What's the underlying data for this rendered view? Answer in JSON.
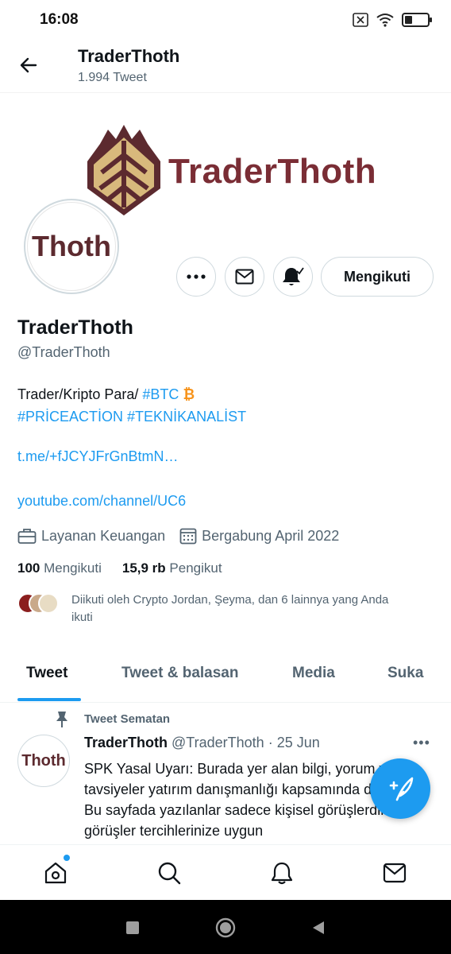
{
  "status_bar": {
    "time": "16:08",
    "battery_level": 0.35
  },
  "header": {
    "title": "TraderThoth",
    "subtitle": "1.994 Tweet"
  },
  "banner": {
    "brand_text": "TraderThoth"
  },
  "avatar": {
    "text": "Thoth"
  },
  "actions": {
    "follow_label": "Mengikuti"
  },
  "profile": {
    "display_name": "TraderThoth",
    "handle": "@TraderThoth",
    "bio_prefix": "Trader/Kripto Para/ ",
    "bio_tag_btc": "#BTC",
    "bio_tag_priceaction": "#PRİCEACTİON",
    "bio_tag_teknikanalist": "#TEKNİKANALİST",
    "link_telegram": "t.me/+fJCYJFrGnBtmN…",
    "link_youtube": "youtube.com/channel/UC6",
    "category": "Layanan Keuangan",
    "joined": "Bergabung April 2022",
    "following_count": "100",
    "following_label": "Mengikuti",
    "followers_count": "15,9 rb",
    "followers_label": "Pengikut",
    "followed_by_text": "Diikuti oleh Crypto Jordan, Şeyma, dan 6 lainnya yang Anda ikuti"
  },
  "tabs": [
    {
      "label": "Tweet",
      "active": true
    },
    {
      "label": "Tweet & balasan",
      "active": false
    },
    {
      "label": "Media",
      "active": false
    },
    {
      "label": "Suka",
      "active": false
    }
  ],
  "pinned_tweet": {
    "pinned_label": "Tweet Sematan",
    "avatar_text": "Thoth",
    "name": "TraderThoth",
    "handle": "@TraderThoth",
    "date": "25 Jun",
    "text": "SPK Yasal Uyarı: Burada yer alan bilgi, yorum ve tavsiyeler yatırım danışmanlığı kapsamında değildir. Bu sayfada yazılanlar sadece kişisel görüşlerdir. Bu görüşler tercihlerinize uygun"
  },
  "colors": {
    "accent": "#1d9bf0",
    "brand": "#7a2d35",
    "muted": "#536471"
  },
  "icons": {
    "back": "arrow-left-icon",
    "more": "more-icon",
    "message": "mail-icon",
    "notify": "bell-icon",
    "category": "briefcase-icon",
    "joined": "calendar-icon",
    "pin": "pin-icon",
    "compose": "compose-icon",
    "nav": [
      "home-icon",
      "search-icon",
      "bell-icon",
      "mail-icon"
    ]
  }
}
